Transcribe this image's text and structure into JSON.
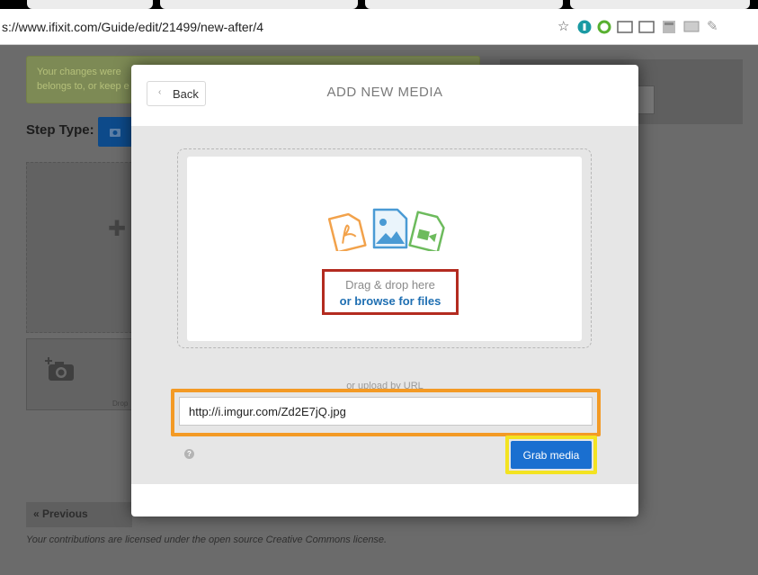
{
  "browser": {
    "url": "s://www.ifixit.com/Guide/edit/21499/new-after/4",
    "extension_icons": [
      "star-icon",
      "shield-icon",
      "refresh-extension-icon",
      "cast-icon",
      "cast-icon",
      "grid-extension-icon",
      "screen-extension-icon",
      "tools-extension-icon"
    ]
  },
  "background_page": {
    "notice_line1": "Your changes were",
    "notice_line2": "belongs to, or keep e",
    "step_type_label": "Step Type:",
    "drag_hint": "Drop",
    "previous_label": "« Previous",
    "license_text": "Your contributions are licensed under the open source Creative Commons license."
  },
  "modal": {
    "back_label": "Back",
    "title": "ADD NEW MEDIA",
    "drop_text": "Drag & drop here",
    "browse_text": "or browse for files",
    "or_url_text": "or upload by URL",
    "url_value": "http://i.imgur.com/Zd2E7jQ.jpg",
    "grab_label": "Grab media",
    "help_glyph": "?"
  },
  "colors": {
    "browse_link": "#1f6fb2",
    "grab_button": "#1a6fd0",
    "highlight_red": "#b32b20",
    "highlight_orange": "#f39a25",
    "highlight_yellow": "#f3e321",
    "pdf_icon": "#f2a24b",
    "image_icon": "#4a9ad4",
    "video_icon": "#6dbb5d"
  }
}
